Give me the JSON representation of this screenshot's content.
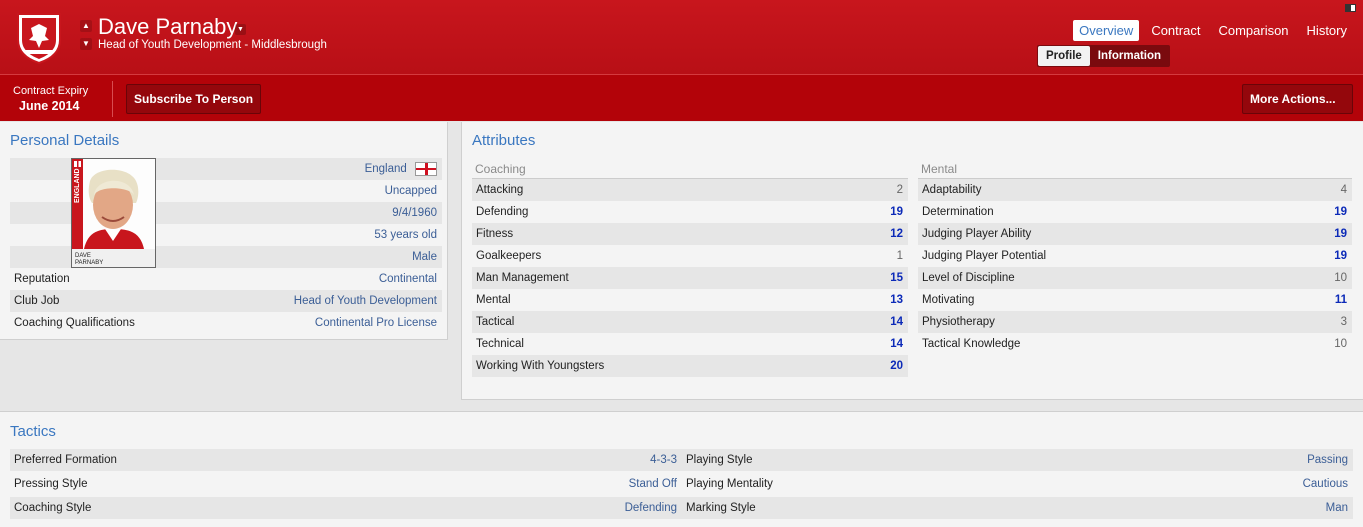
{
  "header": {
    "name": "Dave Parnaby",
    "subtitle": "Head of Youth Development - Middlesbrough",
    "tabs": [
      "Overview",
      "Contract",
      "Comparison",
      "History"
    ],
    "subtabs": [
      "Profile",
      "Information"
    ],
    "accent": "#c8161d"
  },
  "toolbar": {
    "expiry_label": "Contract Expiry",
    "expiry_value": "June 2014",
    "subscribe_label": "Subscribe To Person",
    "more_label": "More Actions..."
  },
  "personal": {
    "title": "Personal Details",
    "nationality": "England",
    "caps": "Uncapped",
    "dob": "9/4/1960",
    "age": "53 years old",
    "gender": "Male",
    "rows": [
      {
        "label": "Reputation",
        "value": "Continental"
      },
      {
        "label": "Club Job",
        "value": "Head of Youth Development"
      },
      {
        "label": "Coaching Qualifications",
        "value": "Continental Pro License"
      }
    ],
    "photo_flag_text": "ENGLAND",
    "photo_caption_1": "DAVE",
    "photo_caption_2": "PARNABY"
  },
  "attributes": {
    "title": "Attributes",
    "coaching_head": "Coaching",
    "mental_head": "Mental",
    "coaching": [
      {
        "label": "Attacking",
        "value": "2",
        "hi": false
      },
      {
        "label": "Defending",
        "value": "19",
        "hi": true
      },
      {
        "label": "Fitness",
        "value": "12",
        "hi": true
      },
      {
        "label": "Goalkeepers",
        "value": "1",
        "hi": false
      },
      {
        "label": "Man Management",
        "value": "15",
        "hi": true
      },
      {
        "label": "Mental",
        "value": "13",
        "hi": true
      },
      {
        "label": "Tactical",
        "value": "14",
        "hi": true
      },
      {
        "label": "Technical",
        "value": "14",
        "hi": true
      },
      {
        "label": "Working With Youngsters",
        "value": "20",
        "hi": true
      }
    ],
    "mental": [
      {
        "label": "Adaptability",
        "value": "4",
        "hi": false
      },
      {
        "label": "Determination",
        "value": "19",
        "hi": true
      },
      {
        "label": "Judging Player Ability",
        "value": "19",
        "hi": true
      },
      {
        "label": "Judging Player Potential",
        "value": "19",
        "hi": true
      },
      {
        "label": "Level of Discipline",
        "value": "10",
        "hi": false
      },
      {
        "label": "Motivating",
        "value": "11",
        "hi": true
      },
      {
        "label": "Physiotherapy",
        "value": "3",
        "hi": false
      },
      {
        "label": "Tactical Knowledge",
        "value": "10",
        "hi": false
      }
    ]
  },
  "tactics": {
    "title": "Tactics",
    "left": [
      {
        "label": "Preferred Formation",
        "value": "4-3-3"
      },
      {
        "label": "Pressing Style",
        "value": "Stand Off"
      },
      {
        "label": "Coaching Style",
        "value": "Defending"
      }
    ],
    "right": [
      {
        "label": "Playing Style",
        "value": "Passing"
      },
      {
        "label": "Playing Mentality",
        "value": "Cautious"
      },
      {
        "label": "Marking Style",
        "value": "Man"
      }
    ]
  }
}
